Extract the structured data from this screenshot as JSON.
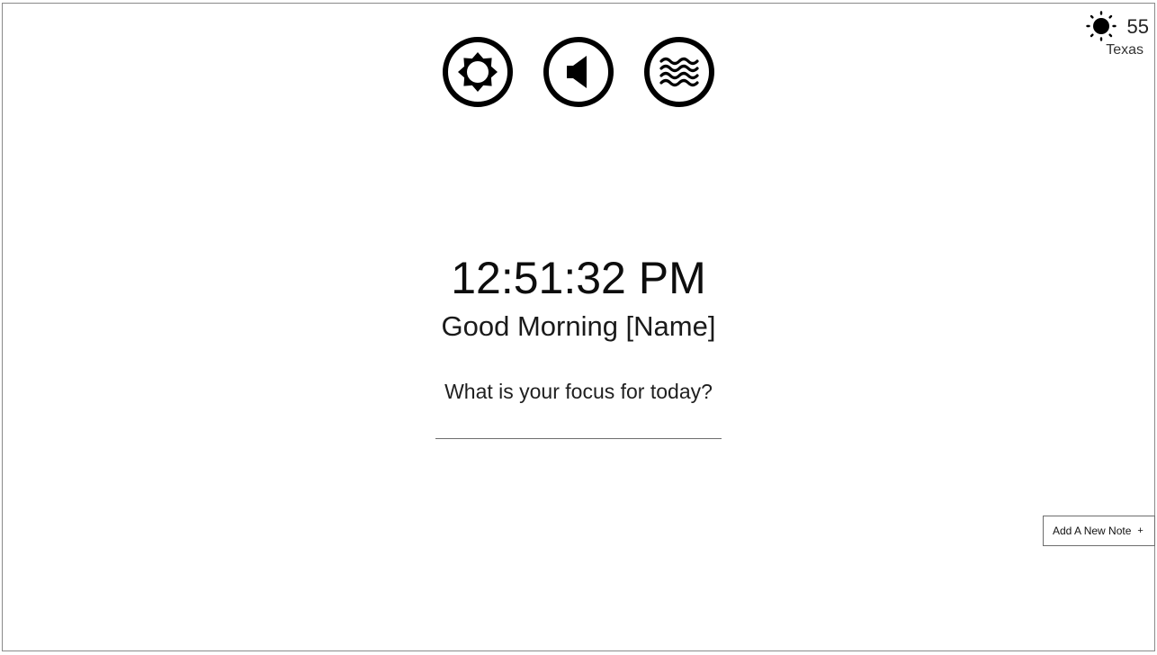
{
  "toolbar": {
    "buttons": [
      {
        "icon": "brightness-icon"
      },
      {
        "icon": "volume-icon"
      },
      {
        "icon": "waves-icon"
      }
    ]
  },
  "weather": {
    "icon": "sun-icon",
    "temperature": "55",
    "location": "Texas"
  },
  "clock": {
    "time": "12:51:32 PM"
  },
  "greeting": {
    "text": "Good Morning [Name]"
  },
  "focus": {
    "question": "What is your focus for today?",
    "value": ""
  },
  "notes": {
    "add_label": "Add A New Note",
    "add_icon": "+"
  }
}
